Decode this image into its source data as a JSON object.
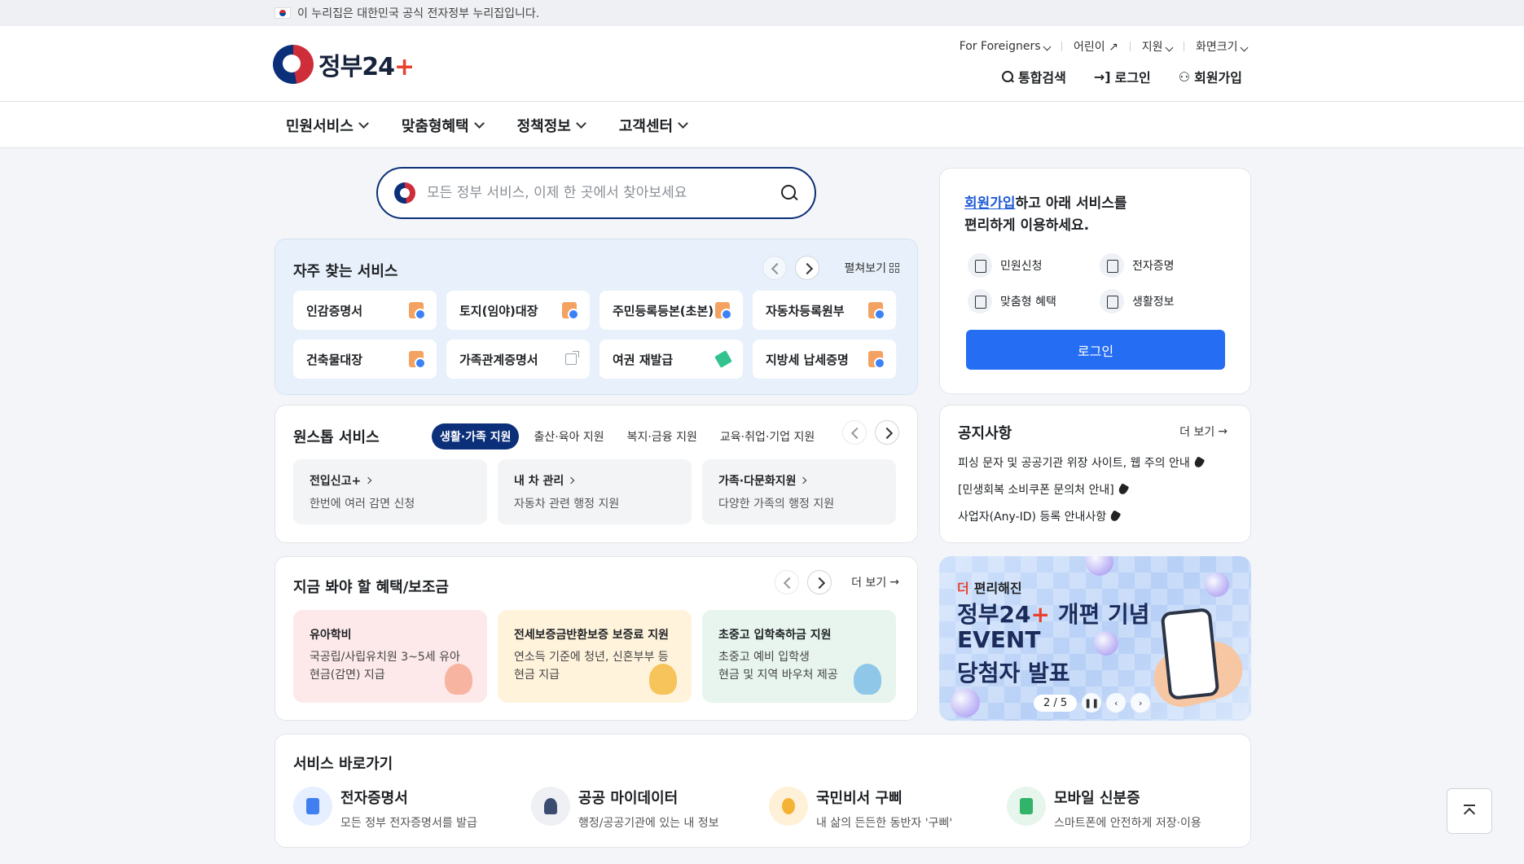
{
  "gov_banner": {
    "text": "이 누리집은 대한민국 공식 전자정부 누리집입니다."
  },
  "header": {
    "logo_text_a": "정부24",
    "logo_plus": "+",
    "utils": [
      "For Foreigners",
      "어린이",
      "지원",
      "화면크기"
    ],
    "actions": {
      "search": "통합검색",
      "login": "로그인",
      "signup": "회원가입"
    }
  },
  "gnb": [
    "민원서비스",
    "맞춤형혜택",
    "정책정보",
    "고객센터"
  ],
  "search": {
    "placeholder": "모든 정부 서비스, 이제 한 곳에서 찾아보세요"
  },
  "frequent": {
    "title": "자주 찾는 서비스",
    "expand": "펼쳐보기",
    "items": [
      "인감증명서",
      "토지(임야)대장",
      "주민등록등본(초본)",
      "자동차등록원부",
      "건축물대장",
      "가족관계증명서",
      "여권 재발급",
      "지방세 납세증명"
    ]
  },
  "onestop": {
    "title": "원스톱 서비스",
    "tabs": [
      "생활·가족 지원",
      "출산·육아 지원",
      "복지·금융 지원",
      "교육·취업·기업 지원"
    ],
    "items": [
      {
        "title": "전입신고+",
        "desc": "한번에 여러 감면 신청"
      },
      {
        "title": "내 차 관리",
        "desc": "자동차 관련 행정 지원"
      },
      {
        "title": "가족·다문화지원",
        "desc": "다양한 가족의 행정 지원"
      }
    ]
  },
  "benefits": {
    "title": "지금 봐야 할 혜택/보조금",
    "more": "더 보기",
    "items": [
      {
        "title": "유아학비",
        "desc1": "국공립/사립유치원 3~5세 유아",
        "desc2": "현금(감면) 지급"
      },
      {
        "title": "전세보증금반환보증 보증료 지원",
        "desc1": "연소득 기준에 청년, 신혼부부 등",
        "desc2": "현금 지급"
      },
      {
        "title": "초중고 입학축하금 지원",
        "desc1": "초중고 예비 입학생",
        "desc2": "현금 및 지역 바우처 제공"
      }
    ]
  },
  "login_card": {
    "join_link": "회원가입",
    "join_rest": "하고 아래 서비스를",
    "join_line2": "편리하게 이용하세요.",
    "quick": [
      "민원신청",
      "전자증명",
      "맞춤형 혜택",
      "생활정보"
    ],
    "login_button": "로그인"
  },
  "notice": {
    "title": "공지사항",
    "more": "더 보기",
    "items": [
      "피싱 문자 및 공공기관 위장 사이트, 웹 주의 안내",
      "[민생회복 소비쿠폰 문의처 안내]",
      "사업자(Any-ID) 등록 안내사항"
    ]
  },
  "banner": {
    "badge": "더",
    "sub": "편리해진",
    "line1": "정부24",
    "line1_rest": " 개편 기념",
    "line2": "EVENT",
    "line3": "당첨자 발표",
    "pager": "2 / 5"
  },
  "shortcuts": {
    "title": "서비스 바로가기",
    "items": [
      {
        "title": "전자증명서",
        "desc": "모든 정부 전자증명서를 발급"
      },
      {
        "title": "공공 마이데이터",
        "desc": "행정/공공기관에 있는 내 정보"
      },
      {
        "title": "국민비서 구삐",
        "desc": "내 삶의 든든한 동반자 '구삐'"
      },
      {
        "title": "모바일 신분증",
        "desc": "스마트폰에 안전하게 저장·이용"
      }
    ]
  },
  "colors": {
    "brand_navy": "#0b2f78",
    "accent_blue": "#256ef4",
    "brand_red": "#e8402f"
  }
}
